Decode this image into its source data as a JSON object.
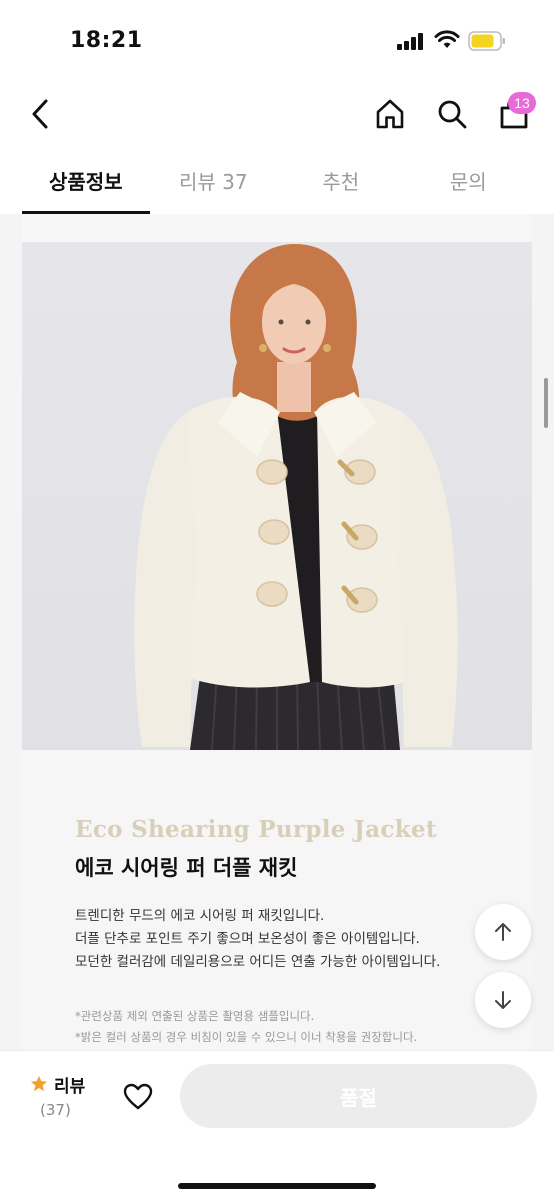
{
  "status": {
    "time": "18:21"
  },
  "header": {
    "cart_count": "13"
  },
  "tabs": [
    {
      "label": "상품정보",
      "active": true
    },
    {
      "label": "리뷰 37",
      "active": false
    },
    {
      "label": "추천",
      "active": false
    },
    {
      "label": "문의",
      "active": false
    }
  ],
  "product": {
    "eng_title": "Eco Shearing Purple Jacket",
    "kor_title": "에코 시어링 퍼 더플 재킷",
    "desc_lines": [
      "트렌디한 무드의 에코 시어링 퍼 재킷입니다.",
      "더플 단추로 포인트 주기 좋으며 보온성이 좋은 아이템입니다.",
      "모던한 컬러감에 데일리용으로 어디든 연출 가능한 아이템입니다."
    ],
    "notes": [
      "*관련상품 제외 연출된 상품은 촬영용 샘플입니다.",
      "*밝은 컬러 상품의 경우 비침이 있을 수 있으니 이너 착용을 권장합니다."
    ]
  },
  "bottom": {
    "review_label": "리뷰",
    "review_count": "(37)",
    "soldout_label": "품절"
  },
  "colors": {
    "accent_badge": "#e86ad8",
    "star": "#f0a22b",
    "title_beige": "#d7cfb8"
  },
  "icons": [
    "back-icon",
    "home-icon",
    "search-icon",
    "cart-icon",
    "arrow-up-icon",
    "arrow-down-icon",
    "star-icon",
    "heart-icon"
  ]
}
